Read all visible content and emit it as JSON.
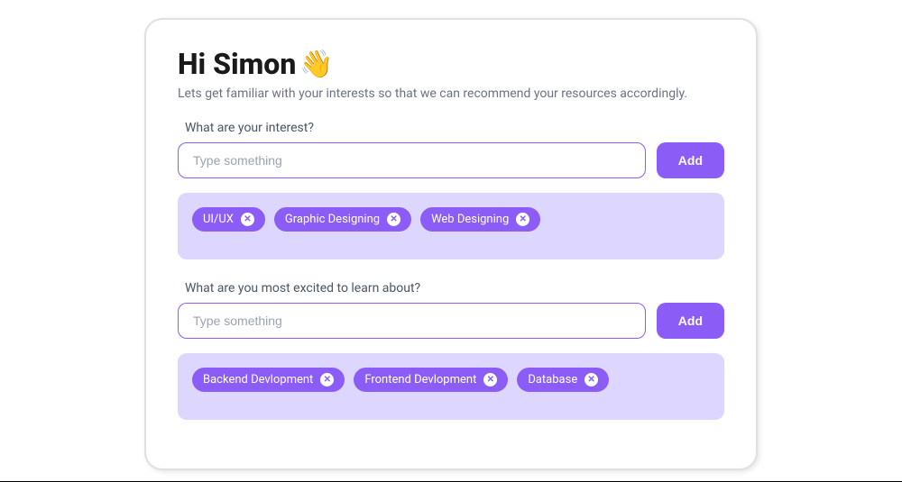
{
  "greeting": {
    "title": "Hi Simon",
    "icon": "👋",
    "subtitle": "Lets get familiar with your interests so that we can recommend your resources accordingly."
  },
  "sections": [
    {
      "label": "What are your interest?",
      "placeholder": "Type something",
      "addLabel": "Add",
      "tags": [
        "UI/UX",
        "Graphic Designing",
        "Web Designing"
      ]
    },
    {
      "label": "What are you most excited to learn about?",
      "placeholder": "Type something",
      "addLabel": "Add",
      "tags": [
        "Backend Devlopment",
        "Frontend Devlopment",
        "Database"
      ]
    }
  ]
}
